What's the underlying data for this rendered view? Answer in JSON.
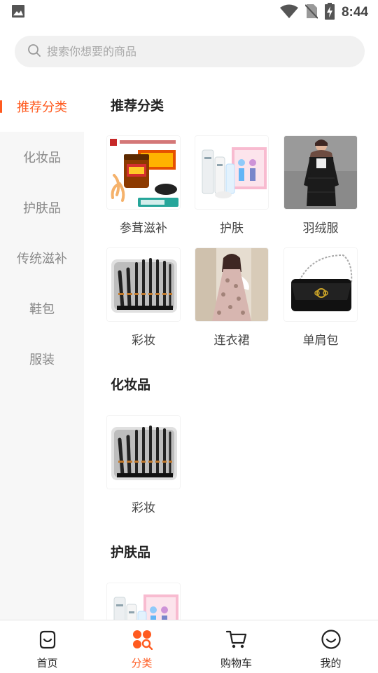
{
  "status_bar": {
    "time": "8:44",
    "left_icon": "image-notification-icon",
    "right_icons": [
      "wifi-icon",
      "no-sim-icon",
      "battery-charging-icon"
    ]
  },
  "search": {
    "placeholder": "搜索你想要的商品",
    "value": ""
  },
  "sidebar": {
    "items": [
      {
        "label": "推荐分类",
        "active": true
      },
      {
        "label": "化妆品",
        "active": false
      },
      {
        "label": "护肤品",
        "active": false
      },
      {
        "label": "传统滋补",
        "active": false
      },
      {
        "label": "鞋包",
        "active": false
      },
      {
        "label": "服装",
        "active": false
      }
    ]
  },
  "sections": [
    {
      "title": "推荐分类",
      "items": [
        {
          "label": "参茸滋补",
          "image": "ginseng-tonic-product"
        },
        {
          "label": "护肤",
          "image": "skincare-set-product"
        },
        {
          "label": "羽绒服",
          "image": "down-jacket-model"
        },
        {
          "label": "彩妆",
          "image": "makeup-brush-set"
        },
        {
          "label": "连衣裙",
          "image": "floral-dress-model"
        },
        {
          "label": "单肩包",
          "image": "black-shoulder-bag"
        }
      ]
    },
    {
      "title": "化妆品",
      "items": [
        {
          "label": "彩妆",
          "image": "makeup-brush-set"
        }
      ]
    },
    {
      "title": "护肤品",
      "items": [
        {
          "label": "",
          "image": "skincare-set-product"
        }
      ]
    }
  ],
  "tabbar": {
    "tabs": [
      {
        "label": "首页",
        "icon": "home-bag-icon",
        "active": false
      },
      {
        "label": "分类",
        "icon": "category-grid-icon",
        "active": true
      },
      {
        "label": "购物车",
        "icon": "cart-icon",
        "active": false
      },
      {
        "label": "我的",
        "icon": "smiley-profile-icon",
        "active": false
      }
    ]
  },
  "colors": {
    "accent": "#ff5a1f",
    "sidebar_bg": "#f7f7f7",
    "search_bg": "#f1f1f1"
  }
}
